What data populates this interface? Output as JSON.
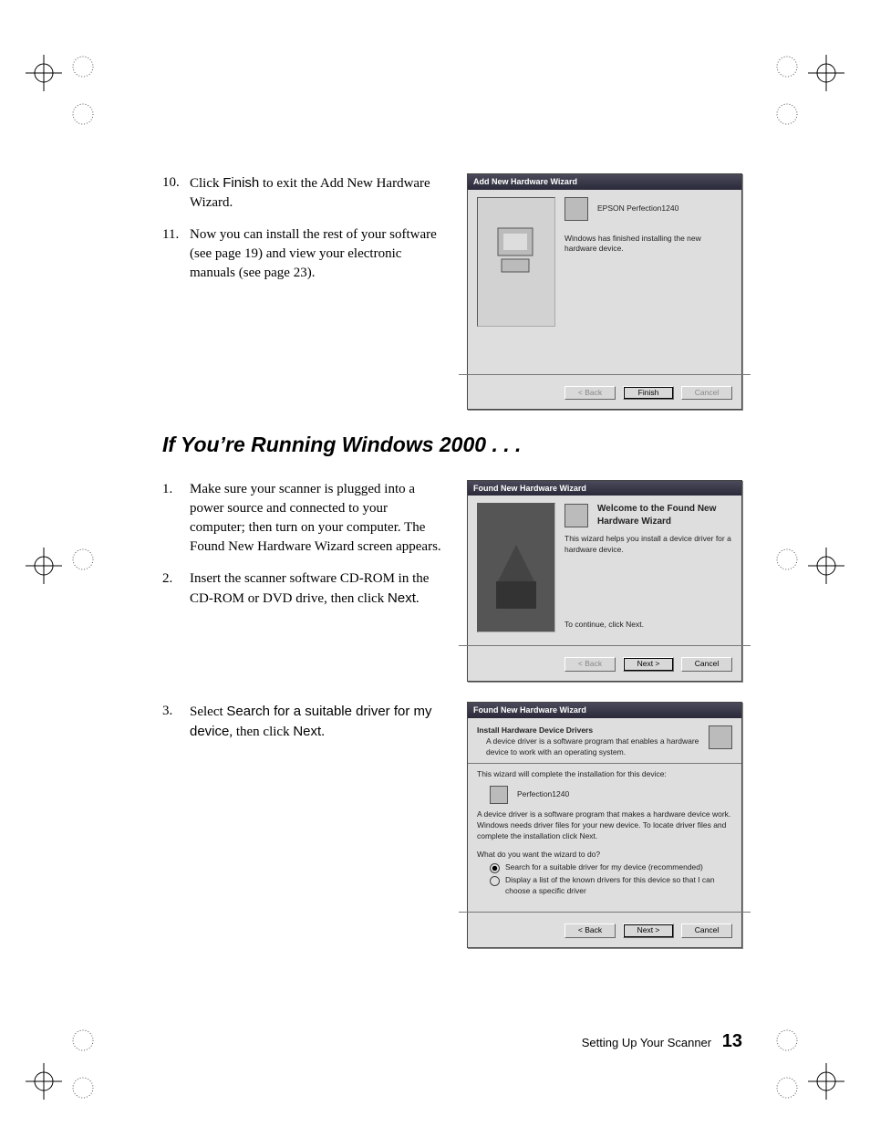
{
  "steps_a": [
    {
      "num": "10.",
      "pre": "Click ",
      "bold": "Finish",
      "post": " to exit the Add New Hardware Wizard."
    },
    {
      "num": "11.",
      "pre": "Now you can install the rest of your software (see page 19) and view your electronic manuals (see page 23).",
      "bold": "",
      "post": ""
    }
  ],
  "heading": "If You’re Running Windows 2000 . . .",
  "steps_b": [
    {
      "num": "1.",
      "pre": "Make sure your scanner is plugged into a power source and connected to your computer; then turn on your computer. The Found New Hardware Wizard screen appears.",
      "bold": "",
      "post": ""
    },
    {
      "num": "2.",
      "pre": "Insert the scanner software CD-ROM in the CD-ROM or DVD drive, then click ",
      "bold": "Next",
      "post": "."
    }
  ],
  "steps_c": [
    {
      "num": "3.",
      "pre": "Select ",
      "bold": "Search for a suitable driver for my device",
      "post": ", then click ",
      "bold2": "Next",
      "post2": "."
    }
  ],
  "dlg1": {
    "title": "Add New Hardware Wizard",
    "device": "EPSON Perfection1240",
    "msg": "Windows has finished installing the new hardware device.",
    "back": "< Back",
    "finish": "Finish",
    "cancel": "Cancel"
  },
  "dlg2": {
    "title": "Found New Hardware Wizard",
    "h": "Welcome to the Found New Hardware Wizard",
    "msg": "This wizard helps you install a device driver for a hardware device.",
    "cont": "To continue, click Next.",
    "back": "< Back",
    "next": "Next >",
    "cancel": "Cancel"
  },
  "dlg3": {
    "title": "Found New Hardware Wizard",
    "h": "Install Hardware Device Drivers",
    "h2": "A device driver is a software program that enables a hardware device to work with an operating system.",
    "line1": "This wizard will complete the installation for this device:",
    "device": "Perfection1240",
    "line2": "A device driver is a software program that makes a hardware device work. Windows needs driver files for your new device. To locate driver files and complete the installation click Next.",
    "prompt": "What do you want the wizard to do?",
    "opt1": "Search for a suitable driver for my device (recommended)",
    "opt2": "Display a list of the known drivers for this device so that I can choose a specific driver",
    "back": "< Back",
    "next": "Next >",
    "cancel": "Cancel"
  },
  "footer": {
    "section": "Setting Up Your Scanner",
    "page": "13"
  }
}
